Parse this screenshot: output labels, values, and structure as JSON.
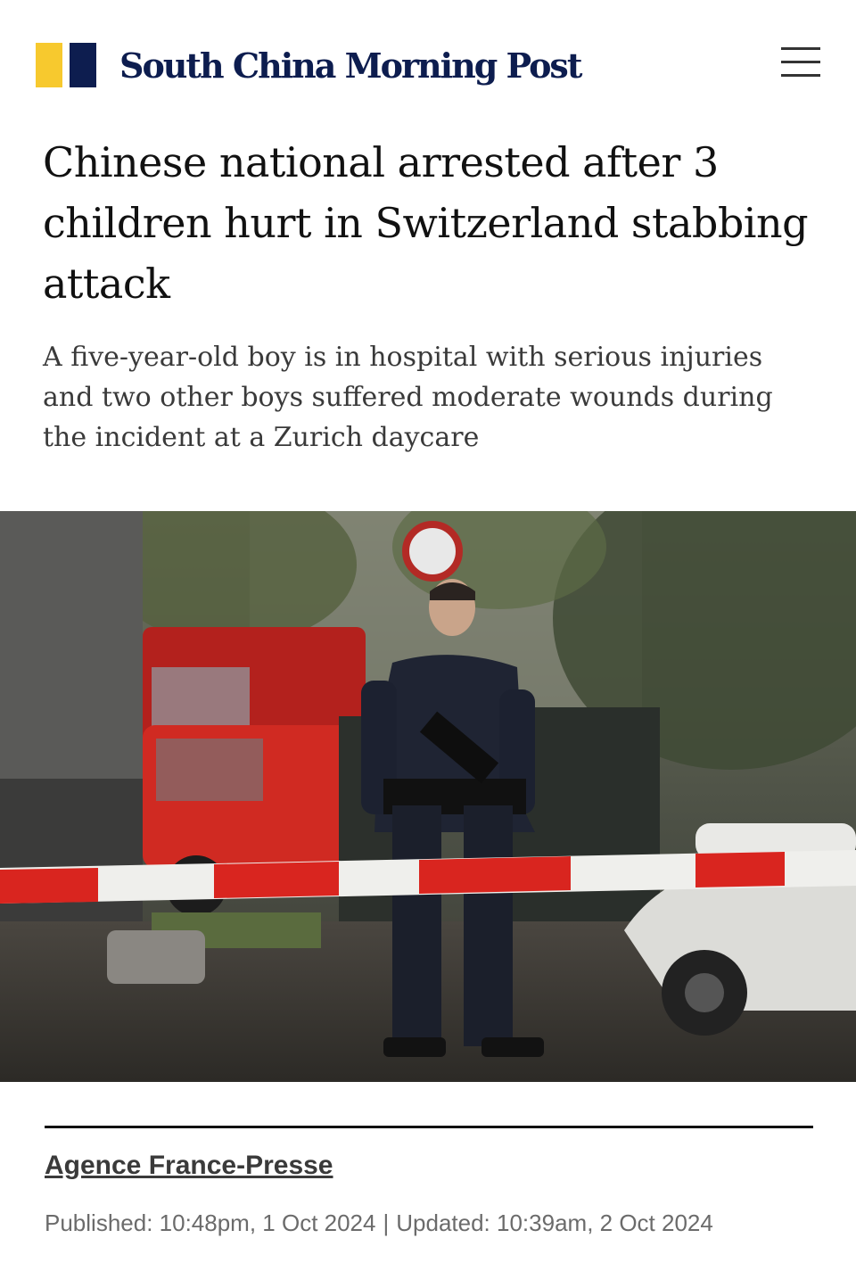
{
  "header": {
    "brand_name": "South China Morning Post",
    "brand_colors": {
      "yellow": "#f7c92e",
      "navy": "#0d1d4f"
    },
    "menu_icon": "hamburger-menu-icon"
  },
  "article": {
    "headline": "Chinese national arrested after 3 children hurt in Switzerland stabbing attack",
    "subheadline": "A five-year-old boy is in hospital with serious injuries and two other boys suffered moderate wounds during the incident at a Zurich daycare",
    "image": {
      "description_icon": "news-photo",
      "next_icon": "arrow-right-icon"
    },
    "byline": {
      "author": "Agence France-Presse",
      "published_label": "Published:",
      "published_value": "10:48pm, 1 Oct 2024",
      "separator": "|",
      "updated_label": "Updated:",
      "updated_value": "10:39am, 2 Oct 2024"
    }
  }
}
